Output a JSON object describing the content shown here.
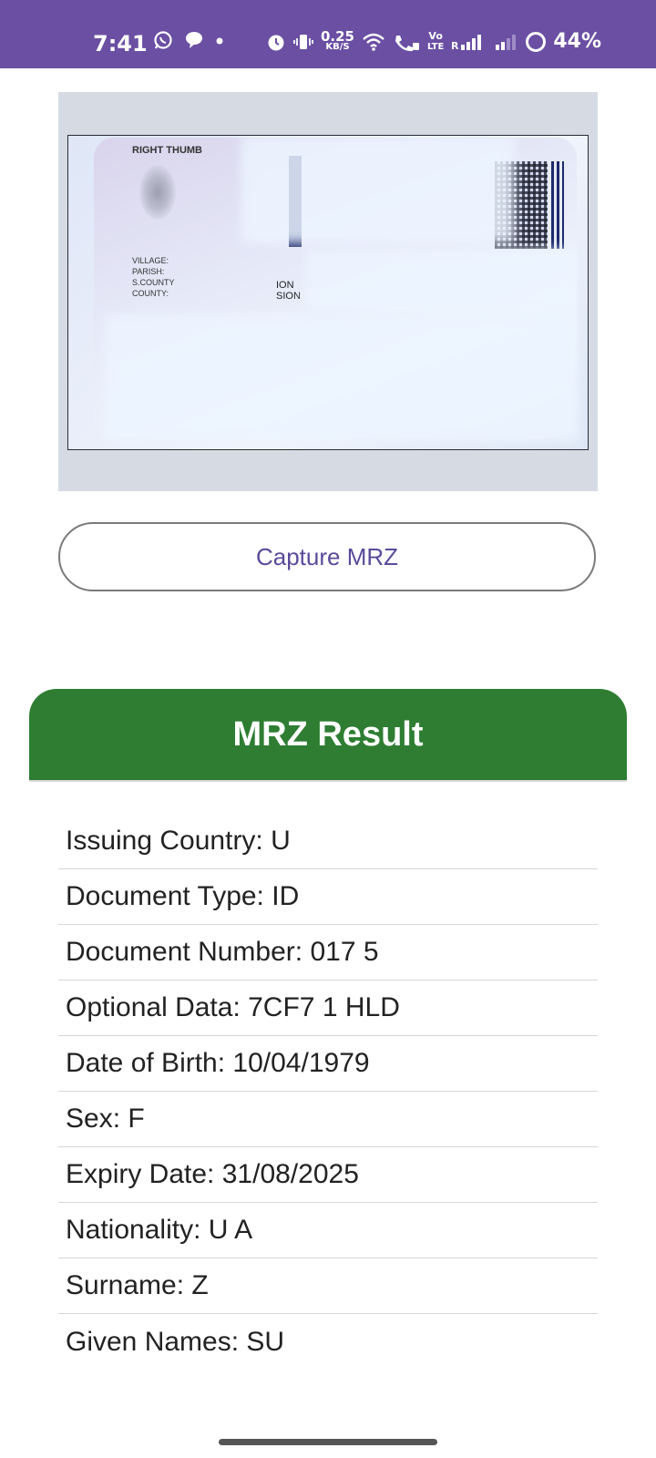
{
  "status_bar": {
    "time": "7:41",
    "net_speed_top": "0.25",
    "net_speed_bottom": "KB/S",
    "volte_top": "Vo",
    "volte_bottom": "LTE",
    "battery": "44%"
  },
  "card_image": {
    "thumb_label": "RIGHT THUMB",
    "field_village": "VILLAGE:",
    "field_parish": "PARISH:",
    "field_scounty": "S.COUNTY",
    "field_county": "COUNTY:",
    "center_text_1": "ION",
    "center_text_2": "SION"
  },
  "capture_button": {
    "label": "Capture MRZ"
  },
  "result": {
    "title": "MRZ Result",
    "rows": [
      {
        "label": "Issuing Country:",
        "value": "U"
      },
      {
        "label": "Document Type:",
        "value": "ID"
      },
      {
        "label": "Document Number:",
        "value": "017  5"
      },
      {
        "label": "Optional Data:",
        "value": "7CF7   1   HLD"
      },
      {
        "label": "Date of Birth:",
        "value": "10/04/1979"
      },
      {
        "label": "Sex:",
        "value": "F"
      },
      {
        "label": "Expiry Date:",
        "value": "31/08/2025"
      },
      {
        "label": "Nationality:",
        "value": "U  A"
      },
      {
        "label": "Surname:",
        "value": "Z"
      },
      {
        "label": "Given Names:",
        "value": "SU"
      }
    ]
  },
  "colors": {
    "status_bar": "#6a4fa3",
    "result_header": "#2e7d32",
    "button_text": "#5b4a9b"
  }
}
